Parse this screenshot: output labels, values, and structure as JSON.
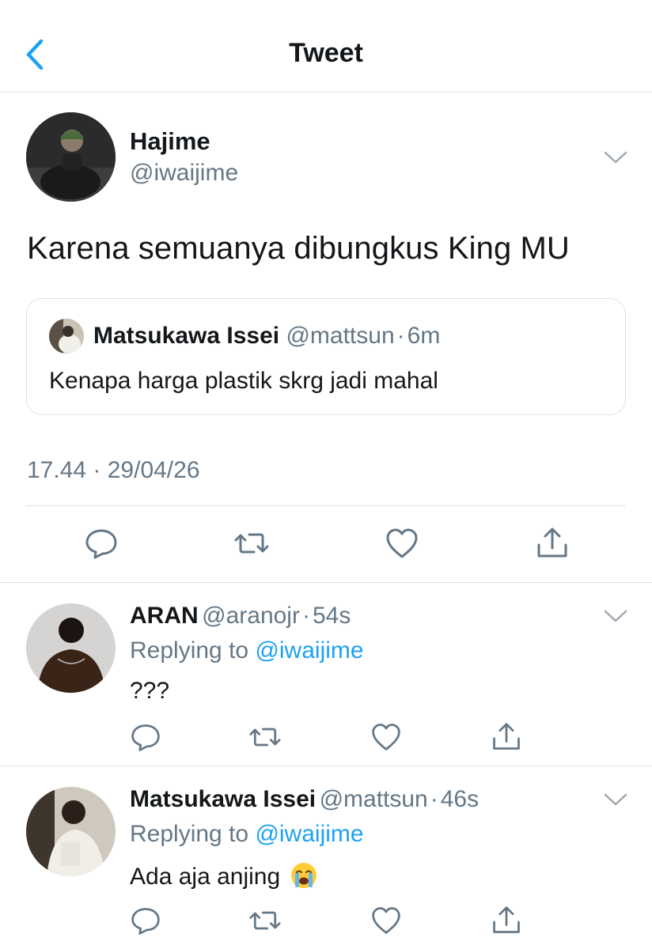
{
  "header": {
    "title": "Tweet",
    "back_icon": "chevron-left-icon",
    "accent": "#1da1f2"
  },
  "main_tweet": {
    "author_name": "Hajime",
    "author_handle": "@iwaijime",
    "text": "Karena semuanya dibungkus King MU",
    "quoted_tweet": {
      "author_name": "Matsukawa Issei",
      "author_handle": "@mattsun",
      "separator": "·",
      "time": "6m",
      "text": "Kenapa harga plastik skrg jadi mahal"
    },
    "timestamp": "17.44 · 29/04/26",
    "actions": [
      "reply-icon",
      "retweet-icon",
      "like-icon",
      "share-icon"
    ]
  },
  "replies": [
    {
      "author_name": "ARAN",
      "author_handle": "@aranojr",
      "separator": "·",
      "time": "54s",
      "replying_prefix": "Replying to",
      "replying_to": "@iwaijime",
      "text": "???"
    },
    {
      "author_name": "Matsukawa Issei",
      "author_handle": "@mattsun",
      "separator": "·",
      "time": "46s",
      "replying_prefix": "Replying to",
      "replying_to": "@iwaijime",
      "text": "Ada aja anjing",
      "emoji": "crying-face-emoji"
    }
  ],
  "colors": {
    "text": "#14171a",
    "secondary": "#657786",
    "border": "#dfe3e7",
    "link": "#1da1f2"
  }
}
